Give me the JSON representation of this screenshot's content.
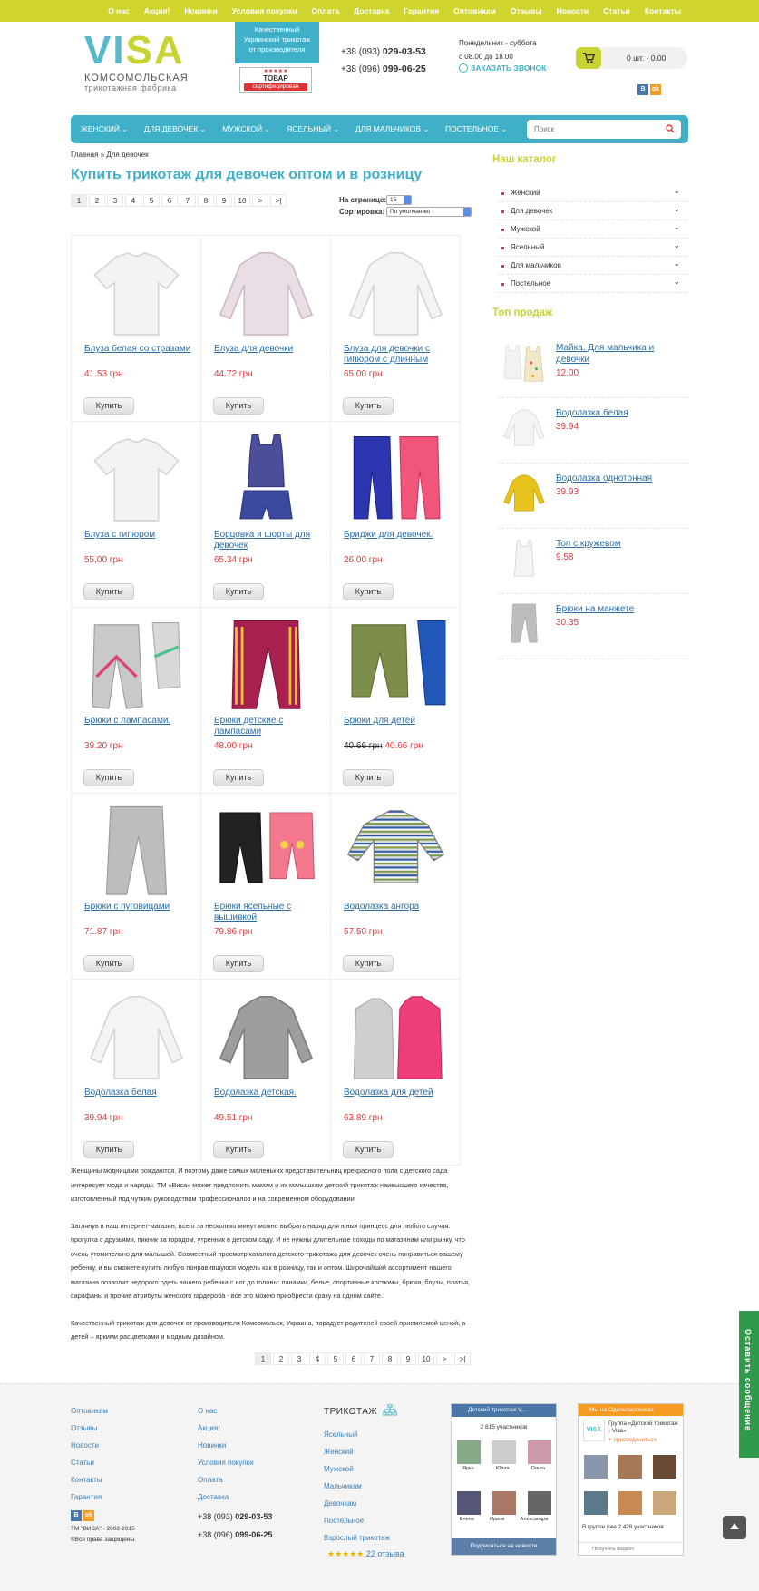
{
  "topnav": [
    "О нас",
    "Акция!",
    "Новинки",
    "Условия покупки",
    "Оплата",
    "Доставка",
    "Гарантия",
    "Оптовикам",
    "Отзывы",
    "Новости",
    "Статьи",
    "Контакты"
  ],
  "logo": {
    "v1": "VI",
    "v2": "SA",
    "sub1": "КОМСОМОЛЬСКАЯ",
    "sub2": "трикотажная фабрика"
  },
  "quality": {
    "line1": "Качественный",
    "line2": "Украинский трикотаж",
    "line3": "от производителя"
  },
  "cert": {
    "stars": "★★★★★",
    "t1": "ТОВАР",
    "t2": "сертифицирован"
  },
  "phones": {
    "p1_prefix": "+38 (093)",
    "p1": "029-03-53",
    "p2_prefix": "+38 (096)",
    "p2": "099-06-25"
  },
  "hours": {
    "line1": "Понедельник - суббота",
    "line2": "с 08.00 до 18.00"
  },
  "callback": "ЗАКАЗАТЬ ЗВОНОК",
  "cart": {
    "text": "0 шт. - 0.00"
  },
  "social": {
    "vk": "В",
    "ok": "ok"
  },
  "mainnav": [
    "ЖЕНСКИЙ",
    "ДЛЯ ДЕВОЧЕК",
    "МУЖСКОЙ",
    "ЯСЕЛЬНЫЙ",
    "ДЛЯ МАЛЬЧИКОВ",
    "ПОСТЕЛЬНОЕ"
  ],
  "search": {
    "placeholder": "Поиск"
  },
  "breadcrumb": "Главная » Для девочек",
  "title": "Купить трикотаж для девочек оптом и в розницу",
  "pager": [
    "1",
    "2",
    "3",
    "4",
    "5",
    "6",
    "7",
    "8",
    "9",
    "10",
    ">",
    ">|"
  ],
  "perpage": {
    "label": "На странице:",
    "value": "15"
  },
  "sort": {
    "label": "Сортировка:",
    "value": "По умолчанию"
  },
  "products": [
    {
      "name": "Блуза белая со стразами",
      "price": "41.53 грн",
      "old": "",
      "img": "tee-white"
    },
    {
      "name": "Блуза для девочки",
      "price": "44.72 грн",
      "old": "",
      "img": "long-pink"
    },
    {
      "name": "Блуза для девочки с гипюром с длинным",
      "price": "65.00 грн",
      "old": "",
      "img": "long-white"
    },
    {
      "name": "Блуза с гипюром",
      "price": "55.00 грн",
      "old": "",
      "img": "tee-white"
    },
    {
      "name": "Борцовка и шорты для девочек",
      "price": "65.34 грн",
      "old": "",
      "img": "tank-set"
    },
    {
      "name": "Бриджи для девочек.",
      "price": "26.00 грн",
      "old": "",
      "img": "pants-bp"
    },
    {
      "name": "Брюки с лампасами.",
      "price": "39.20 грн",
      "old": "",
      "img": "pants-grey"
    },
    {
      "name": "Брюки детские с лампасами",
      "price": "48.00 грн",
      "old": "",
      "img": "pants-red"
    },
    {
      "name": "Брюки для детей",
      "price": "40.66 грн",
      "old": "40.66 грн",
      "img": "pants-og"
    },
    {
      "name": "Брюки с пуговицами",
      "price": "71.87 грн",
      "old": "",
      "img": "pants-grey1"
    },
    {
      "name": "Брюки ясельные с вышивкой",
      "price": "79.86 грн",
      "old": "",
      "img": "pants-bk"
    },
    {
      "name": "Водолазка ангора",
      "price": "57.50 грн",
      "old": "",
      "img": "striped"
    },
    {
      "name": "Водолазка белая",
      "price": "39.94 грн",
      "old": "",
      "img": "long-white"
    },
    {
      "name": "Водолазка детская.",
      "price": "49.51 грн",
      "old": "",
      "img": "long-grey"
    },
    {
      "name": "Водолазка для детей",
      "price": "63.89 грн",
      "old": "",
      "img": "long-gp"
    }
  ],
  "buy_label": "Купить",
  "description": [
    "Женщины модницами рождаются. И поэтому даже самых маленьких представительниц прекрасного пола с детского сада интересует мода и наряды. ТМ «Виса» может предложить мамам и их малышкам детский трикотаж наивысшего качества, изготовленный под чутким руководством профессионалов и на современном оборудовании.",
    "Заглянув в наш интернет-магазин, всего за несколько минут можно выбрать наряд для юных принцесс для любого случая: прогулка с друзьями, пикник за городом, утренник в детском саду. И не нужны длительные походы по магазинам или рынку, что очень утомительно для малышей. Совместный просмотр каталога детского трикотажа для девочек очень понравиться вашему ребенку, и вы сможете купить любую понравившуюся модель как в розницу, так и оптом. Широчайший ассортимент нашего магазина позволит недорого одеть вашего ребенка с ног до головы: панамки, белье, спортивные костюмы, брюки, блузы, платья, сарафаны и прочие атрибуты женского гардероба - все это можно приобрести сразу на одном сайте.",
    "Качественный трикотаж для девочек от производителя Комсомольск, Украина, порадует родителей своей приемлемой ценой, а детей – яркими расцветками и модным дизайном."
  ],
  "sidebar": {
    "catalog_title": "Наш каталог",
    "catalog": [
      "Женский",
      "Для девочек",
      "Мужской",
      "Ясельный",
      "Для мальчиков",
      "Постельное"
    ],
    "top_title": "Топ продаж",
    "top": [
      {
        "name": "Майка. Для мальчика и девочки",
        "price": "12.00",
        "img": "tank-duo"
      },
      {
        "name": "Водолазка белая",
        "price": "39.94",
        "img": "long-white"
      },
      {
        "name": "Водолазка однотонная",
        "price": "39.93",
        "img": "long-yellow"
      },
      {
        "name": "Топ с кружевом",
        "price": "9.58",
        "img": "tank-white"
      },
      {
        "name": "Брюки на манжете",
        "price": "30.35",
        "img": "pants-grey1"
      }
    ]
  },
  "footer": {
    "col1": [
      "Оптовикам",
      "Отзывы",
      "Новости",
      "Статьи",
      "Контакты",
      "Гарантия"
    ],
    "copyright1": "ТМ \"ВИСА\" - 2002-2015",
    "copyright2": "©Все права защищены.",
    "col2": [
      "О нас",
      "Акция!",
      "Новинки",
      "Условия покупки",
      "Оплата",
      "Доставка"
    ],
    "phone1_prefix": "+38 (093)",
    "phone1": "029-03-53",
    "phone2_prefix": "+38 (096)",
    "phone2": "099-06-25",
    "col3_title": "ТРИКОТАЖ",
    "col3": [
      "Ясельный",
      "Женский",
      "Мужской",
      "Мальчикам",
      "Девочкам",
      "Постельное",
      "Взрослый трикотаж"
    ],
    "reviews_stars": "★★★★★",
    "reviews": "22 отзыва",
    "vk_widget": {
      "head": "Детский трикотаж V...",
      "members": "2 815 участников",
      "names": [
        "Ярко",
        "Юлия",
        "Ольга",
        "Елена",
        "Ирина",
        "Александра"
      ],
      "button": "Подписаться на новости"
    },
    "ok_widget": {
      "head": "Мы на Одноклассниках",
      "group": "Группа «Детский трикотаж - Visa»",
      "join": "присоединиться",
      "count": "В группе уже 2 428 участников",
      "footer": "Получить виджет"
    }
  },
  "feedback": "Оставить сообщение",
  "colors": {
    "accent": "#3fb0c8",
    "lime": "#c8d233",
    "price": "#e03b3b",
    "link": "#2a6ea8"
  }
}
